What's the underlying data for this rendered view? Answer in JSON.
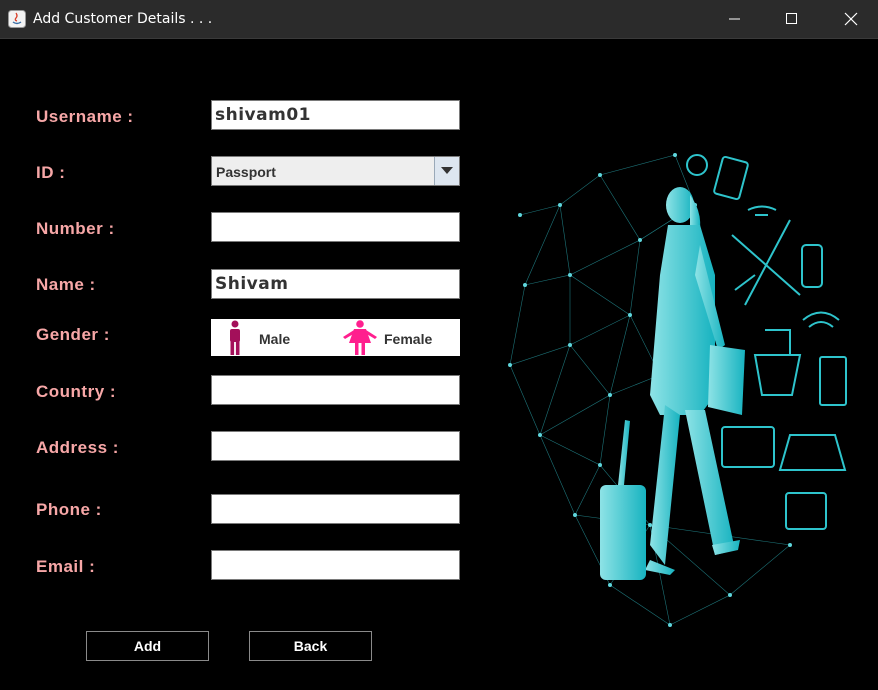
{
  "window": {
    "title": "Add Customer Details . . ."
  },
  "form": {
    "username_label": "Username :",
    "username_value": "shivam01",
    "id_label": "ID :",
    "id_value": "Passport",
    "number_label": "Number :",
    "number_value": "",
    "name_label": "Name :",
    "name_value": "Shivam",
    "gender_label": "Gender :",
    "gender_options": [
      "Male",
      "Female"
    ],
    "country_label": "Country :",
    "country_value": "",
    "address_label": "Address :",
    "address_value": "",
    "phone_label": "Phone :",
    "phone_value": "",
    "email_label": "Email :",
    "email_value": ""
  },
  "buttons": {
    "add": "Add",
    "back": "Back"
  },
  "colors": {
    "label": "#f7a7a7",
    "male_icon": "#a3105a",
    "female_icon": "#ff1f8e",
    "illustration": "#2ec4cc"
  }
}
